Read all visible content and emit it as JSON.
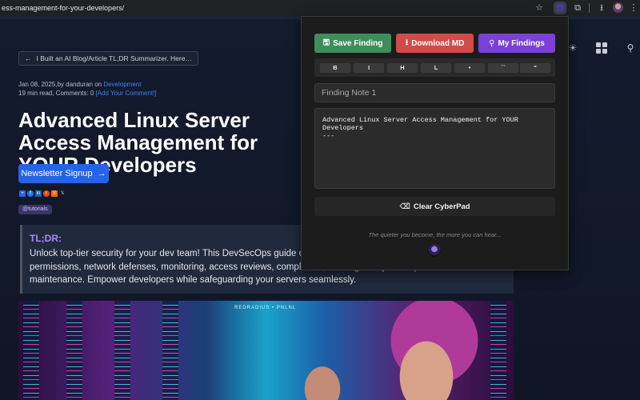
{
  "browser": {
    "url": "ess-management-for-your-developers/"
  },
  "article": {
    "back_link": "I Built an AI Blog/Article TL;DR Summarizer. Here…",
    "meta_date_author": "Jan 08, 2025,by danduran on ",
    "meta_category": "Development",
    "meta_read": "19 min read, Comments: 0 ",
    "meta_add_comment": "[Add Your Comment!]",
    "title": "Advanced Linux Server Access Management for YOUR Developers",
    "newsletter_label": "Newsletter Signup",
    "tag": "@tutorials",
    "tldr_heading": "TL;DR:",
    "tldr_body": "Unlock top-tier security for your dev team! This DevSecOps guide covers Linux server access management, permissions, network defenses, monitoring, access reviews, compliance, and regular system updates and maintenance. Empower developers while safeguarding your servers seamlessly.",
    "hero_label": "REDRADIUS • PNLNL"
  },
  "popup": {
    "save_label": "Save Finding",
    "download_label": "Download MD",
    "findings_label": "My Findings",
    "format_buttons": [
      "B",
      "I",
      "H",
      "L",
      "•",
      "``",
      "\""
    ],
    "note_placeholder": "Finding Note 1",
    "note_content": "Advanced Linux Server Access Management for YOUR\nDevelopers\n---",
    "clear_label": "Clear CyberPad",
    "quote": "The quieter you become, the more you can hear..."
  },
  "colors": {
    "save": "#3c8f5a",
    "download": "#d24a4a",
    "findings": "#7a40d8",
    "link": "#3b82f6",
    "newsletter": "#2563eb",
    "tldr_heading": "#a78bfa"
  }
}
